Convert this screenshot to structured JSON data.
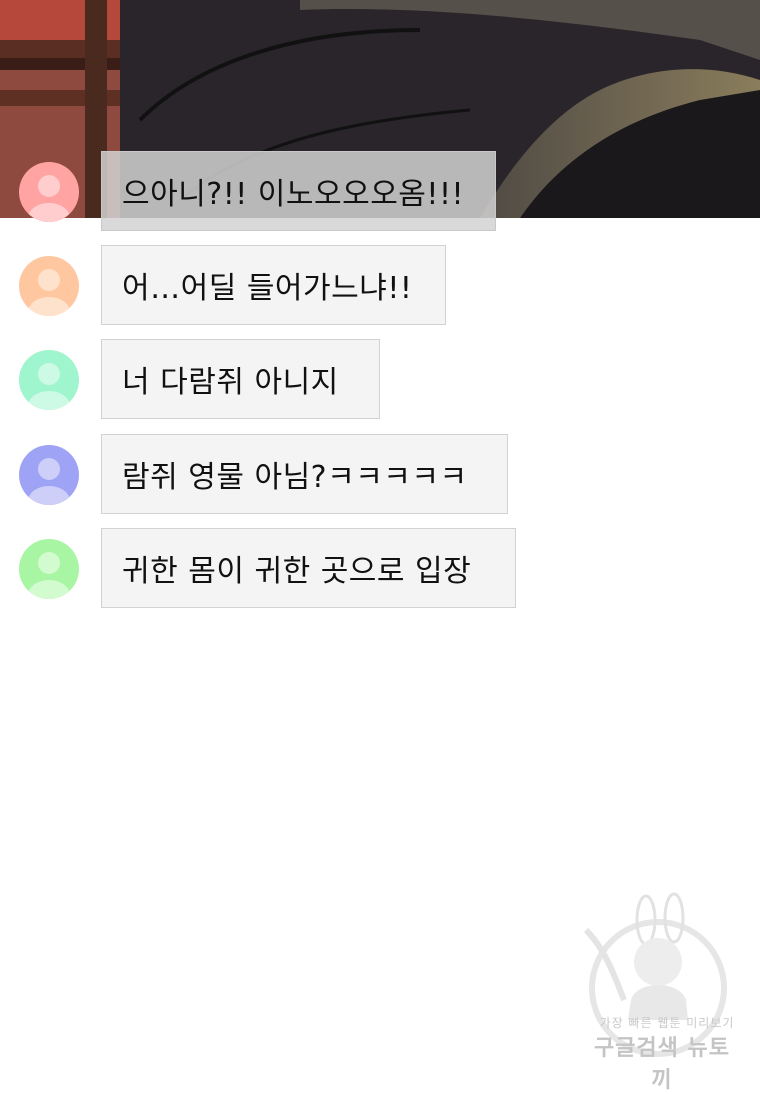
{
  "comments": [
    {
      "text": "으아니?!! 이노오오오옴!!!",
      "avatar_color": "#ffa3a3"
    },
    {
      "text": "어…어딜 들어가느냐!!",
      "avatar_color": "#ffc79f"
    },
    {
      "text": "너 다람쥐 아니지",
      "avatar_color": "#9ff5cd"
    },
    {
      "text": "람쥐 영물 아님?ㅋㅋㅋㅋㅋ",
      "avatar_color": "#9fa3f5"
    },
    {
      "text": "귀한 몸이 귀한 곳으로 입장",
      "avatar_color": "#a8f5a3"
    }
  ],
  "watermark": {
    "line1": "가장 빠른 웹툰 미리보기",
    "line2": "구글검색 뉴토끼"
  }
}
